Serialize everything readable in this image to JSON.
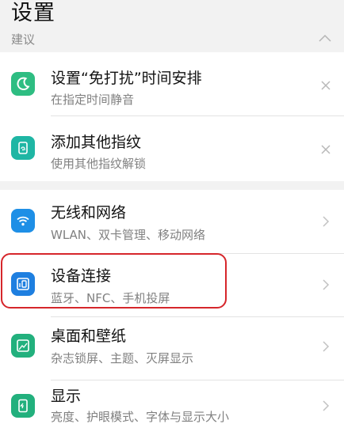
{
  "header": {
    "title": "设置"
  },
  "suggest": {
    "section_label": "建议",
    "items": [
      {
        "label": "设置“免打扰”时间安排",
        "sub": "在指定时间静音",
        "icon": "moon-icon",
        "color": "#2ebd82",
        "action": "dismiss"
      },
      {
        "label": "添加其他指纹",
        "sub": "使用其他指纹解锁",
        "icon": "fingerprint-icon",
        "color": "#1fb6a4",
        "action": "dismiss"
      }
    ]
  },
  "settings": {
    "items": [
      {
        "label": "无线和网络",
        "sub": "WLAN、双卡管理、移动网络",
        "icon": "wifi-icon",
        "color": "#1e8fe6"
      },
      {
        "label": "设备连接",
        "sub": "蓝牙、NFC、手机投屏",
        "icon": "device-connection-icon",
        "color": "#1e7fe0"
      },
      {
        "label": "桌面和壁纸",
        "sub": "杂志锁屏、主题、灭屏显示",
        "icon": "wallpaper-icon",
        "color": "#22b07d"
      },
      {
        "label": "显示",
        "sub": "亮度、护眼模式、字体与显示大小",
        "icon": "display-icon",
        "color": "#22b07d"
      }
    ]
  },
  "highlight": {
    "target": "设备连接",
    "color": "#d6262b"
  }
}
